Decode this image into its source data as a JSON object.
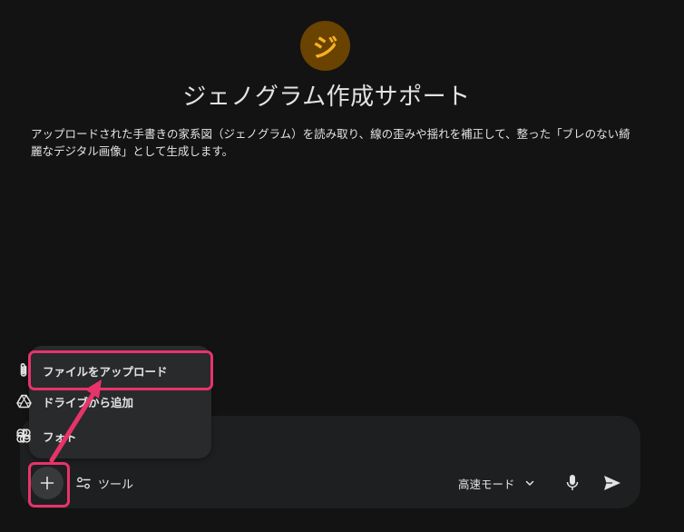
{
  "gem": {
    "avatar_glyph": "ジ",
    "title": "ジェノグラム作成サポート",
    "description": "アップロードされた手書きの家系図（ジェノグラム）を読み取り、線の歪みや揺れを補正して、整った「ブレのない綺麗なデジタル画像」として生成します。"
  },
  "upload_menu": {
    "items": [
      {
        "label": "ファイルをアップロード",
        "icon": "paperclip-icon"
      },
      {
        "label": "ドライブから追加",
        "icon": "drive-icon"
      },
      {
        "label": "フォト",
        "icon": "photos-icon"
      }
    ]
  },
  "composer": {
    "tools_label": "ツール",
    "mode_label": "高速モード"
  },
  "colors": {
    "background": "#131314",
    "panel": "#1e1f20",
    "menu": "#282a2c",
    "highlight": "#e8336a",
    "avatar_bg": "#6a4300",
    "avatar_fg": "#f6b224"
  }
}
